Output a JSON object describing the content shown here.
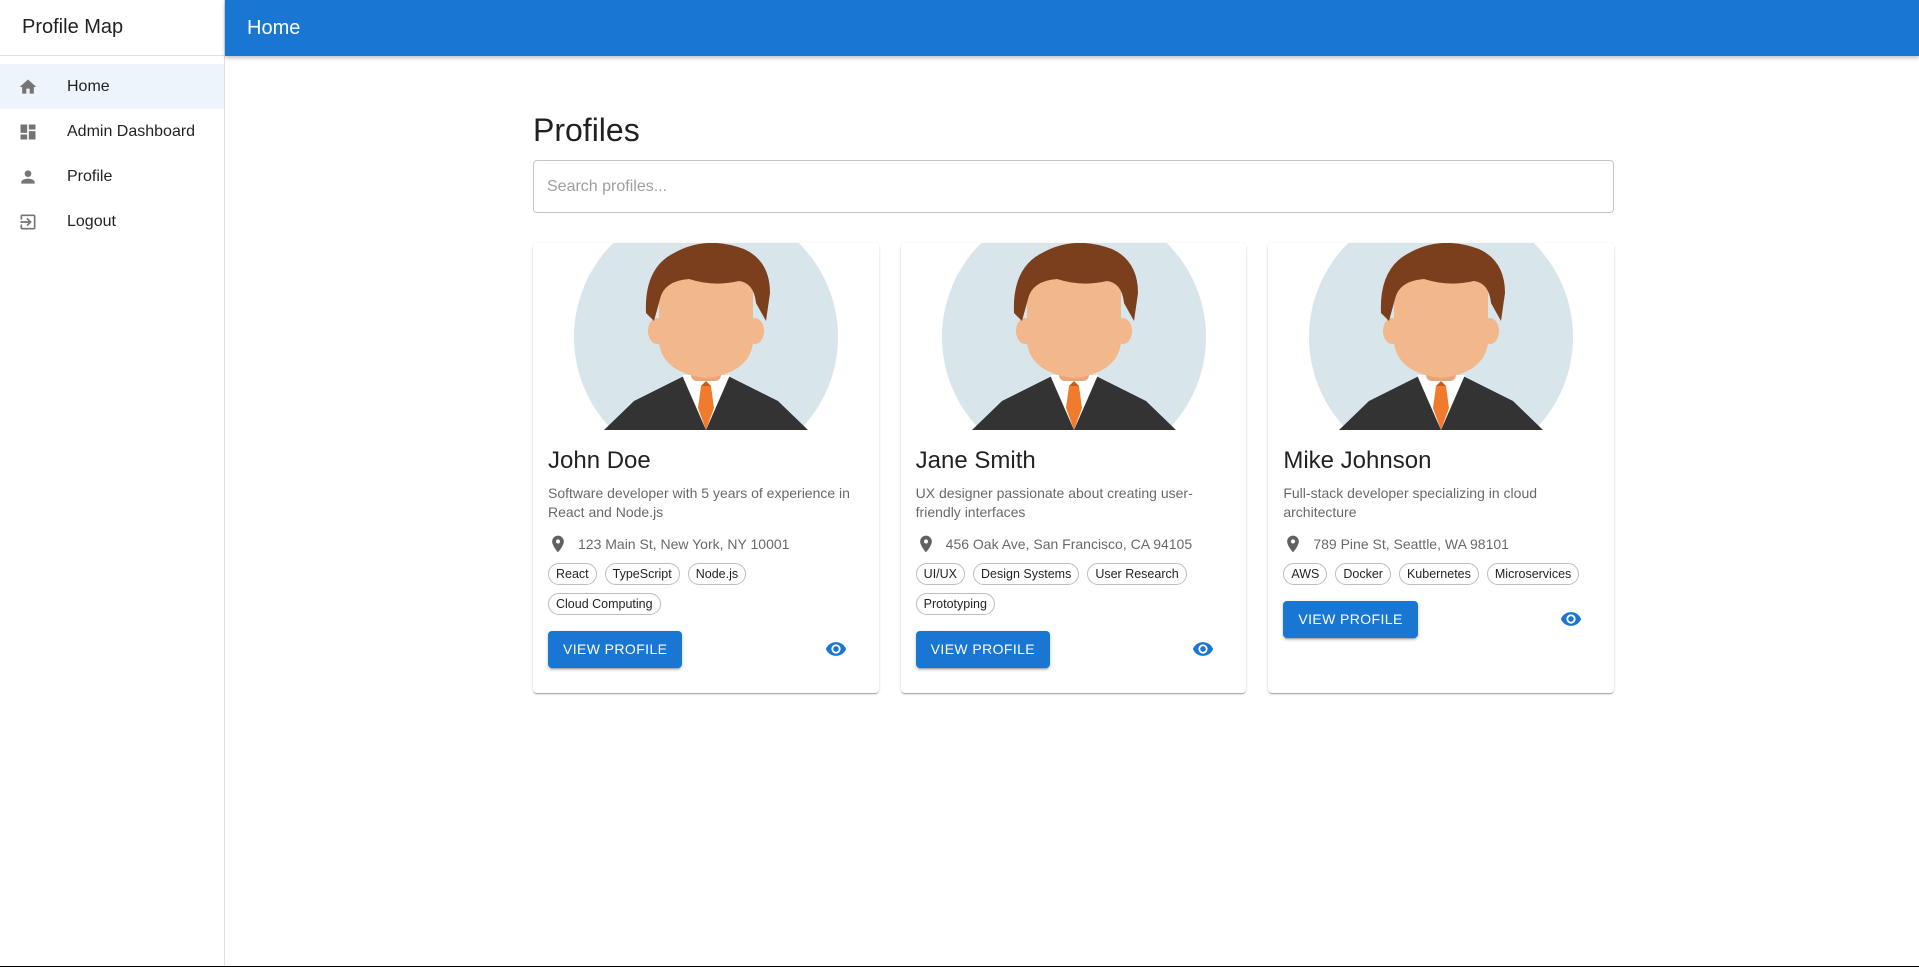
{
  "sidebar": {
    "title": "Profile Map",
    "items": [
      {
        "label": "Home",
        "icon": "home-icon",
        "active": true
      },
      {
        "label": "Admin Dashboard",
        "icon": "dashboard-icon",
        "active": false
      },
      {
        "label": "Profile",
        "icon": "person-icon",
        "active": false
      },
      {
        "label": "Logout",
        "icon": "logout-icon",
        "active": false
      }
    ]
  },
  "appbar": {
    "title": "Home"
  },
  "main": {
    "title": "Profiles",
    "search": {
      "placeholder": "Search profiles...",
      "value": ""
    },
    "profiles": [
      {
        "name": "John Doe",
        "description": "Software developer with 5 years of experience in React and Node.js",
        "location": "123 Main St, New York, NY 10001",
        "tags": [
          "React",
          "TypeScript",
          "Node.js",
          "Cloud Computing"
        ],
        "button_label": "VIEW PROFILE"
      },
      {
        "name": "Jane Smith",
        "description": "UX designer passionate about creating user-friendly interfaces",
        "location": "456 Oak Ave, San Francisco, CA 94105",
        "tags": [
          "UI/UX",
          "Design Systems",
          "User Research",
          "Prototyping"
        ],
        "button_label": "VIEW PROFILE"
      },
      {
        "name": "Mike Johnson",
        "description": "Full-stack developer specializing in cloud architecture",
        "location": "789 Pine St, Seattle, WA 98101",
        "tags": [
          "AWS",
          "Docker",
          "Kubernetes",
          "Microservices"
        ],
        "button_label": "VIEW PROFILE"
      }
    ]
  },
  "colors": {
    "primary": "#1976d2",
    "active_nav_bg": "#edf4fc",
    "avatar_bg": "#d8e6ec",
    "hair": "#7b3f1d",
    "skin": "#f2b78b",
    "suit": "#333333",
    "tie": "#f07b2c"
  }
}
